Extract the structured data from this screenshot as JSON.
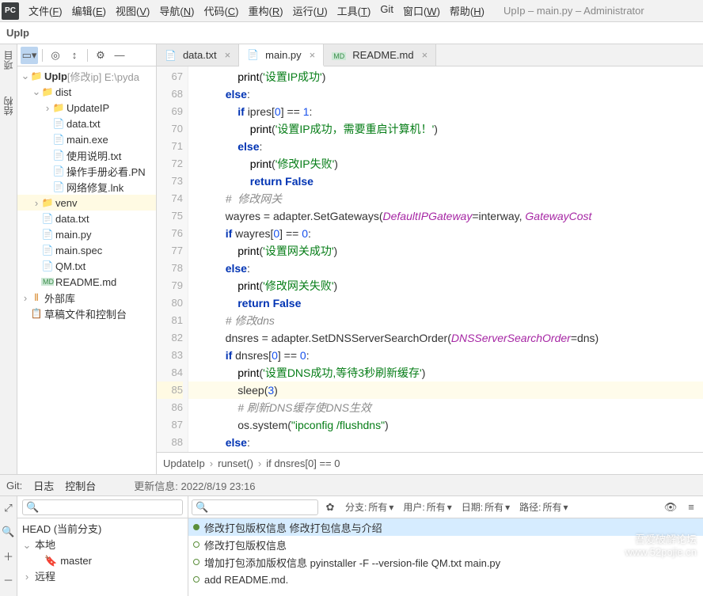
{
  "window": {
    "title_suffix": "UpIp – main.py – Administrator"
  },
  "menu": [
    "文件(F)",
    "编辑(E)",
    "视图(V)",
    "导航(N)",
    "代码(C)",
    "重构(R)",
    "运行(U)",
    "工具(T)",
    "Git",
    "窗口(W)",
    "帮助(H)"
  ],
  "crumb": "UpIp",
  "project_tool_tab": "项目",
  "structure_tool_tab": "结构",
  "tree": {
    "root": {
      "name": "UpIp",
      "suffix": "[修改ip]  E:\\pyda"
    },
    "dist": "dist",
    "dist_children": [
      "UpdateIP",
      "data.txt",
      "main.exe",
      "使用说明.txt",
      "操作手册必看.PN",
      "网络修复.lnk"
    ],
    "venv": "venv",
    "post_venv": [
      "data.txt",
      "main.py",
      "main.spec",
      "QM.txt",
      "README.md"
    ],
    "external": "外部库",
    "scratch": "草稿文件和控制台"
  },
  "tabs": [
    {
      "name": "data.txt",
      "active": false
    },
    {
      "name": "main.py",
      "active": true
    },
    {
      "name": "README.md",
      "active": false
    }
  ],
  "line_start": 67,
  "line_highlight": 85,
  "code": [
    {
      "indent": 16,
      "tokens": [
        {
          "t": "print",
          "c": "fn"
        },
        {
          "t": "("
        },
        {
          "t": "'设置IP成功'",
          "c": "str"
        },
        {
          "t": ")"
        }
      ]
    },
    {
      "indent": 12,
      "tokens": [
        {
          "t": "else",
          "c": "kw"
        },
        {
          "t": ":"
        }
      ]
    },
    {
      "indent": 16,
      "tokens": [
        {
          "t": "if ",
          "c": "kw"
        },
        {
          "t": "ipres["
        },
        {
          "t": "0",
          "c": "num"
        },
        {
          "t": "] == "
        },
        {
          "t": "1",
          "c": "num"
        },
        {
          "t": ":"
        }
      ]
    },
    {
      "indent": 20,
      "tokens": [
        {
          "t": "print",
          "c": "fn"
        },
        {
          "t": "("
        },
        {
          "t": "'设置IP成功，需要重启计算机！'",
          "c": "str"
        },
        {
          "t": ")"
        }
      ]
    },
    {
      "indent": 16,
      "tokens": [
        {
          "t": "else",
          "c": "kw"
        },
        {
          "t": ":"
        }
      ]
    },
    {
      "indent": 20,
      "tokens": [
        {
          "t": "print",
          "c": "fn"
        },
        {
          "t": "("
        },
        {
          "t": "'修改IP失败'",
          "c": "str"
        },
        {
          "t": ")"
        }
      ]
    },
    {
      "indent": 20,
      "tokens": [
        {
          "t": "return ",
          "c": "kw"
        },
        {
          "t": "False",
          "c": "kw"
        }
      ]
    },
    {
      "indent": 12,
      "tokens": [
        {
          "t": "#  修改网关",
          "c": "cmt"
        }
      ]
    },
    {
      "indent": 12,
      "tokens": [
        {
          "t": "wayres = adapter.SetGateways("
        },
        {
          "t": "DefaultIPGateway",
          "c": "param"
        },
        {
          "t": "=interway, "
        },
        {
          "t": "GatewayCost",
          "c": "param"
        }
      ]
    },
    {
      "indent": 12,
      "tokens": [
        {
          "t": "if ",
          "c": "kw"
        },
        {
          "t": "wayres["
        },
        {
          "t": "0",
          "c": "num"
        },
        {
          "t": "] == "
        },
        {
          "t": "0",
          "c": "num"
        },
        {
          "t": ":"
        }
      ]
    },
    {
      "indent": 16,
      "tokens": [
        {
          "t": "print",
          "c": "fn"
        },
        {
          "t": "("
        },
        {
          "t": "'设置网关成功'",
          "c": "str"
        },
        {
          "t": ")"
        }
      ]
    },
    {
      "indent": 12,
      "tokens": [
        {
          "t": "else",
          "c": "kw"
        },
        {
          "t": ":"
        }
      ]
    },
    {
      "indent": 16,
      "tokens": [
        {
          "t": "print",
          "c": "fn"
        },
        {
          "t": "("
        },
        {
          "t": "'修改网关失败'",
          "c": "str"
        },
        {
          "t": ")"
        }
      ]
    },
    {
      "indent": 16,
      "tokens": [
        {
          "t": "return ",
          "c": "kw"
        },
        {
          "t": "False",
          "c": "kw"
        }
      ]
    },
    {
      "indent": 12,
      "tokens": [
        {
          "t": "# 修改dns",
          "c": "cmt"
        }
      ]
    },
    {
      "indent": 12,
      "tokens": [
        {
          "t": "dnsres = adapter.SetDNSServerSearchOrder("
        },
        {
          "t": "DNSServerSearchOrder",
          "c": "param"
        },
        {
          "t": "=dns)"
        }
      ]
    },
    {
      "indent": 12,
      "tokens": [
        {
          "t": "if ",
          "c": "kw"
        },
        {
          "t": "dnsres["
        },
        {
          "t": "0",
          "c": "num"
        },
        {
          "t": "] == "
        },
        {
          "t": "0",
          "c": "num"
        },
        {
          "t": ":"
        }
      ]
    },
    {
      "indent": 16,
      "tokens": [
        {
          "t": "print",
          "c": "fn"
        },
        {
          "t": "("
        },
        {
          "t": "'设置DNS成功,等待3秒刷新缓存'",
          "c": "str"
        },
        {
          "t": ")"
        }
      ]
    },
    {
      "indent": 16,
      "hl": true,
      "tokens": [
        {
          "t": "sleep("
        },
        {
          "t": "3",
          "c": "num"
        },
        {
          "t": ")"
        }
      ]
    },
    {
      "indent": 16,
      "tokens": [
        {
          "t": "# 刷新DNS缓存使DNS生效",
          "c": "cmt"
        }
      ]
    },
    {
      "indent": 16,
      "tokens": [
        {
          "t": "os.system("
        },
        {
          "t": "\"ipconfig /flushdns\"",
          "c": "str"
        },
        {
          "t": ")"
        }
      ]
    },
    {
      "indent": 12,
      "tokens": [
        {
          "t": "else",
          "c": "kw"
        },
        {
          "t": ":"
        }
      ]
    },
    {
      "indent": 16,
      "tokens": [
        {
          "t": "",
          "c": ""
        }
      ]
    }
  ],
  "breadcrumb": [
    "UpdateIp",
    "runset()",
    "if dnsres[0] == 0"
  ],
  "gitbar": {
    "git": "Git:",
    "log": "日志",
    "console": "控制台",
    "status": "更新信息: 2022/8/19 23:16"
  },
  "filters": {
    "branch_lbl": "分支:",
    "all": "所有",
    "user_lbl": "用户:",
    "date_lbl": "日期:",
    "path_lbl": "路径:"
  },
  "branches": {
    "head": "HEAD (当前分支)",
    "local": "本地",
    "master": "master",
    "remote": "远程"
  },
  "commits": [
    {
      "msg": "修改打包版权信息 修改打包信息与介绍",
      "hl": true
    },
    {
      "msg": "修改打包版权信息",
      "hl": false
    },
    {
      "msg": "增加打包添加版权信息 pyinstaller -F --version-file QM.txt main.py",
      "hl": false
    },
    {
      "msg": "add README.md.",
      "hl": false
    }
  ],
  "watermark": {
    "l1": "吾爱破解论坛",
    "l2": "www.52pojie.cn"
  }
}
